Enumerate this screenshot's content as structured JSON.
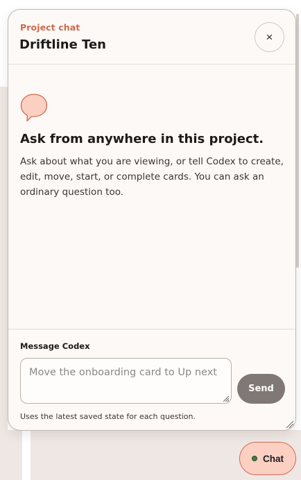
{
  "header": {
    "eyebrow": "Project chat",
    "title": "Driftline Ten",
    "close_label": "×"
  },
  "empty_state": {
    "icon": "speech-bubble-icon",
    "title": "Ask from anywhere in this project.",
    "description": "Ask about what you are viewing, or tell Codex to create, edit, move, start, or complete cards. You can ask an ordinary question too."
  },
  "composer": {
    "label": "Message Codex",
    "placeholder": "Move the onboarding card to Up next",
    "value": "",
    "send_label": "Send",
    "hint": "Uses the latest saved state for each question."
  },
  "fab": {
    "label": "Chat",
    "status": "online"
  },
  "colors": {
    "accent": "#cf6a4e",
    "panel_bg": "#fdf9f6",
    "send_button": "#7f7875",
    "fab_bg": "#fbd0c3",
    "status_dot": "#3d7d45"
  }
}
